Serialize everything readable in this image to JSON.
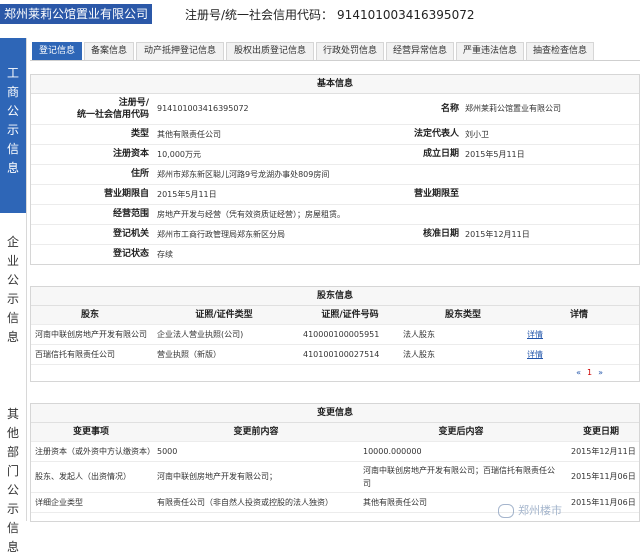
{
  "header": {
    "company": "郑州莱莉公馆置业有限公司",
    "reg_label": "注册号/统一社会信用代码：",
    "reg_value": "914101003416395072"
  },
  "sidebar": {
    "section1": "工商公示信息",
    "section2": "企业公示信息",
    "section3": "其他部门公示信息"
  },
  "tabs": [
    {
      "label": "登记信息"
    },
    {
      "label": "备案信息"
    },
    {
      "label": "动产抵押登记信息"
    },
    {
      "label": "股权出质登记信息"
    },
    {
      "label": "行政处罚信息"
    },
    {
      "label": "经营异常信息"
    },
    {
      "label": "严重违法信息"
    },
    {
      "label": "抽查检查信息"
    }
  ],
  "basic": {
    "title": "基本信息",
    "reg_no_label_1": "注册号/",
    "reg_no_label_2": "统一社会信用代码",
    "reg_no": "914101003416395072",
    "name_label": "名称",
    "name": "郑州莱莉公馆置业有限公司",
    "type_label": "类型",
    "type": "其他有限责任公司",
    "legal_label": "法定代表人",
    "legal": "刘小卫",
    "capital_label": "注册资本",
    "capital": "10,000万元",
    "est_label": "成立日期",
    "est": "2015年5月11日",
    "address_label": "住所",
    "address": "郑州市郑东新区聪儿河路9号龙湖办事处809房间",
    "term_from_label": "营业期限自",
    "term_from": "2015年5月11日",
    "term_to_label": "营业期限至",
    "term_to": "",
    "scope_label": "经营范围",
    "scope": "房地产开发与经营（凭有效资质证经营）；房屋租赁。",
    "authority_label": "登记机关",
    "authority": "郑州市工商行政管理局郑东新区分局",
    "approve_label": "核准日期",
    "approve": "2015年12月11日",
    "status_label": "登记状态",
    "status": "存续"
  },
  "shareholders": {
    "title": "股东信息",
    "headers": [
      "股东",
      "证照/证件类型",
      "证照/证件号码",
      "股东类型",
      "详情"
    ],
    "rows": [
      {
        "name": "河南中联创房地产开发有限公司",
        "id_type": "企业法人营业执照(公司)",
        "id_no": "410000100005951",
        "kind": "法人股东",
        "detail": "详情"
      },
      {
        "name": "百瑞信托有限责任公司",
        "id_type": "营业执照（新版）",
        "id_no": "410100100027514",
        "kind": "法人股东",
        "detail": "详情"
      }
    ],
    "pager_prev": "«",
    "pager_page": "1",
    "pager_next": "»"
  },
  "changes": {
    "title": "变更信息",
    "headers": [
      "变更事项",
      "变更前内容",
      "变更后内容",
      "变更日期"
    ],
    "rows": [
      {
        "item": "注册资本（或外资中方认缴资本）",
        "before": "5000",
        "after": "10000.000000",
        "date": "2015年12月11日"
      },
      {
        "item": "股东、发起人（出资情况）",
        "before": "河南中联创房地产开发有限公司；",
        "after": "河南中联创房地产开发有限公司；百瑞信托有限责任公司",
        "date": "2015年11月06日"
      },
      {
        "item": "详细企业类型",
        "before": "有限责任公司（非自然人投资或控股的法人独资）",
        "after": "其他有限责任公司",
        "date": "2015年11月06日"
      }
    ]
  },
  "watermark": "郑州楼市"
}
